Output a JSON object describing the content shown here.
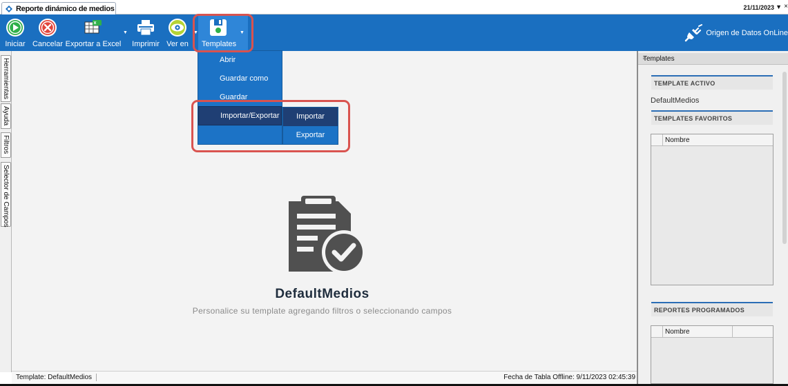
{
  "app": {
    "tab_title": "Reporte dinámico de medios",
    "date": "21/11/2023",
    "close_glyph": "×"
  },
  "toolbar": {
    "buttons": [
      {
        "label": "Iniciar",
        "icon": "play-icon"
      },
      {
        "label": "Cancelar",
        "icon": "cancel-icon"
      },
      {
        "label": "Exportar a Excel",
        "icon": "excel-icon"
      },
      {
        "label": "Imprimir",
        "icon": "printer-icon"
      },
      {
        "label": "Ver en",
        "icon": "eye-icon"
      },
      {
        "label": "Templates",
        "icon": "floppy-icon"
      }
    ],
    "data_source_label": "Origen de Datos OnLine",
    "colors": {
      "ribbon": "#1a6fc0",
      "highlight": "#d9534f"
    }
  },
  "side_tabs": [
    "Herramientas",
    "Ayuda",
    "Filtros",
    "Selector de Campos"
  ],
  "templates_menu": {
    "items": [
      "Abrir",
      "Guardar como",
      "Guardar",
      "Importar/Exportar"
    ],
    "active_item": "Importar/Exportar",
    "submenu": [
      "Importar",
      "Exportar"
    ],
    "active_submenu": "Importar"
  },
  "main": {
    "title": "DefaultMedios",
    "subtitle": "Personalice su template agregando filtros o seleccionando campos"
  },
  "status": {
    "template": "Template: DefaultMedios",
    "offline_date": "Fecha de Tabla Offline: 9/11/2023 02:45:39"
  },
  "right_panel": {
    "header": "Templates",
    "active_section": "TEMPLATE ACTIVO",
    "active_value": "DefaultMedios",
    "favorites_section": "TEMPLATES FAVORITOS",
    "favorites_column": "Nombre",
    "scheduled_section": "REPORTES PROGRAMADOS",
    "scheduled_column": "Nombre"
  }
}
